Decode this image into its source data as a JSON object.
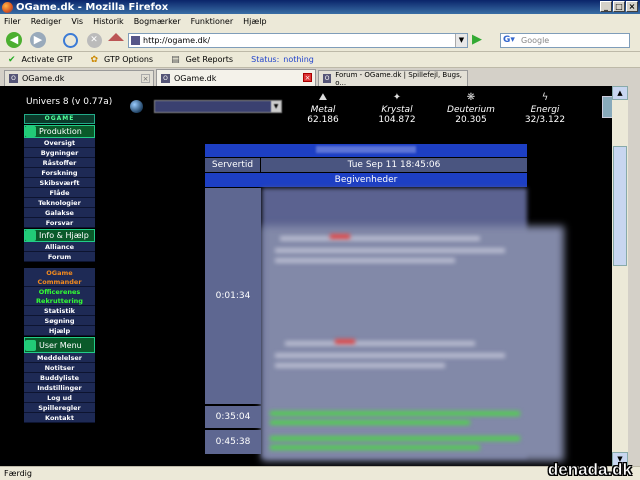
{
  "window": {
    "title": "OGame.dk - Mozilla Firefox"
  },
  "menu": [
    "Filer",
    "Rediger",
    "Vis",
    "Historik",
    "Bogmærker",
    "Funktioner",
    "Hjælp"
  ],
  "nav": {
    "url": "http://ogame.dk/",
    "search_placeholder": "Google"
  },
  "bookmarks": {
    "activate": "Activate GTP",
    "options": "GTP Options",
    "reports": "Get Reports",
    "status_label": "Status:",
    "status_value": "nothing"
  },
  "tabs": [
    {
      "label": "OGame.dk"
    },
    {
      "label": "OGame.dk"
    },
    {
      "label": "Forum - OGame.dk | Spillefejl, Bugs, o..."
    }
  ],
  "game": {
    "univ_label": "Univers 8",
    "version": "(v 0.77a)",
    "logo": "OGAME",
    "sections": {
      "produktion": "Produktion",
      "info": "Info & Hjælp",
      "user": "User Menu"
    },
    "menu_produktion": [
      "Oversigt",
      "Bygninger",
      "Råstoffer",
      "Forskning",
      "Skibsværft",
      "Flåde",
      "Teknologier",
      "Galakse",
      "Forsvar"
    ],
    "menu_info": [
      "Alliance",
      "Forum"
    ],
    "commander": [
      "OGame",
      "Commander"
    ],
    "officers": [
      "Officerenes",
      "Rekruttering"
    ],
    "menu_info2": [
      "Statistik",
      "Søgning",
      "Hjælp"
    ],
    "menu_user": [
      "Meddelelser",
      "Notitser",
      "Buddyliste",
      "Indstillinger",
      "Log ud",
      "Spilleregler",
      "Kontakt"
    ],
    "resources": {
      "metal_label": "Metal",
      "metal": "62.186",
      "krystal_label": "Krystal",
      "krystal": "104.872",
      "deut_label": "Deuterium",
      "deut": "20.305",
      "energi_label": "Energi",
      "energi": "32/3.122"
    },
    "servertid_label": "Servertid",
    "servertid": "Tue Sep 11 18:45:06",
    "events_head": "Begivenheder",
    "event_times": [
      "0:01:34",
      "0:35:04",
      "0:45:38"
    ]
  },
  "status": {
    "text": "Færdig"
  },
  "watermark": "denada.dk"
}
